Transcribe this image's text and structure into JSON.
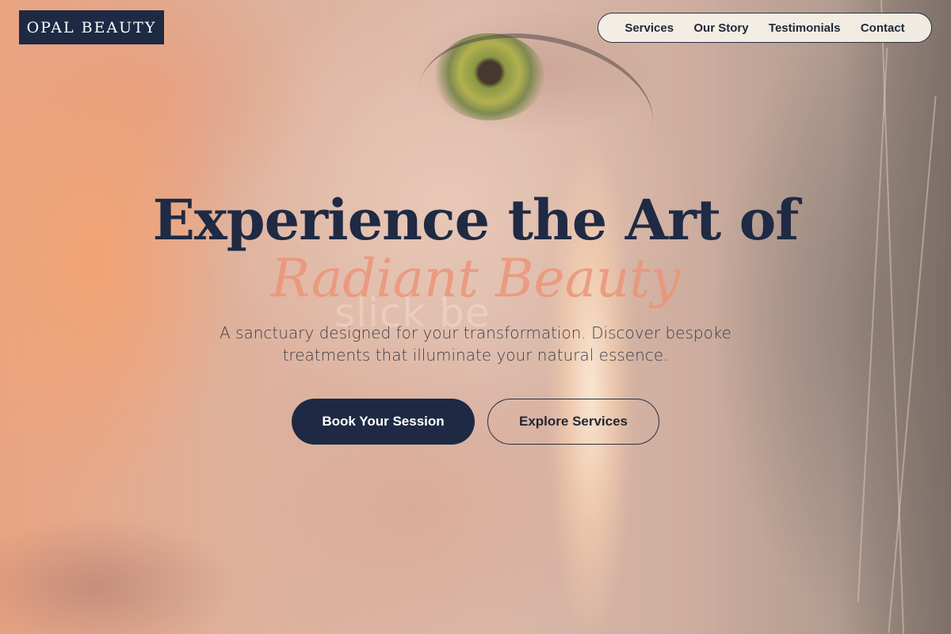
{
  "brand": {
    "logo_text": "OPAL BEAUTY",
    "color": "#1e2a44"
  },
  "nav": {
    "items": [
      {
        "label": "Services"
      },
      {
        "label": "Our Story"
      },
      {
        "label": "Testimonials"
      },
      {
        "label": "Contact"
      }
    ]
  },
  "hero": {
    "title": "Experience the Art of",
    "accent": "Radiant Beauty",
    "ghost_text": "slick be",
    "subtitle": "A sanctuary designed for your transformation. Discover bespoke treatments that illuminate your natural essence.",
    "primary_button": "Book Your Session",
    "secondary_button": "Explore Services"
  },
  "colors": {
    "accent": "#ec9276",
    "dark_navy": "#1e2a44"
  }
}
